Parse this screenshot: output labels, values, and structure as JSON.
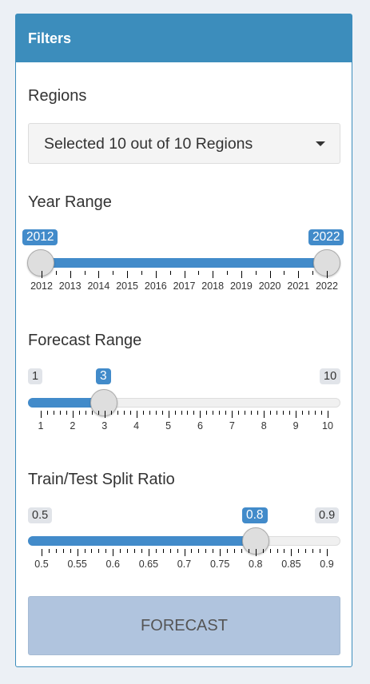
{
  "panel": {
    "title": "Filters"
  },
  "regions": {
    "label": "Regions",
    "selected": "Selected 10 out of 10 Regions"
  },
  "year_range": {
    "label": "Year Range",
    "min": "2012",
    "max": "2022",
    "from": "2012",
    "to": "2022",
    "ticks": [
      "2012",
      "2013",
      "2014",
      "2015",
      "2016",
      "2017",
      "2018",
      "2019",
      "2020",
      "2021",
      "2022"
    ]
  },
  "forecast_range": {
    "label": "Forecast Range",
    "min": "1",
    "max": "10",
    "value": "3",
    "ticks": [
      "1",
      "2",
      "3",
      "4",
      "5",
      "6",
      "7",
      "8",
      "9",
      "10"
    ]
  },
  "split_ratio": {
    "label": "Train/Test Split Ratio",
    "min": "0.5",
    "max": "0.9",
    "value": "0.8",
    "ticks": [
      "0.5",
      "0.55",
      "0.6",
      "0.65",
      "0.7",
      "0.75",
      "0.8",
      "0.85",
      "0.9"
    ]
  },
  "forecast_button": {
    "label": "FORECAST"
  },
  "colors": {
    "accent": "#3c8dbc",
    "bar": "#428bca",
    "button": "#b0c4de"
  },
  "icons": {
    "dropdown": "caret-down-icon"
  }
}
